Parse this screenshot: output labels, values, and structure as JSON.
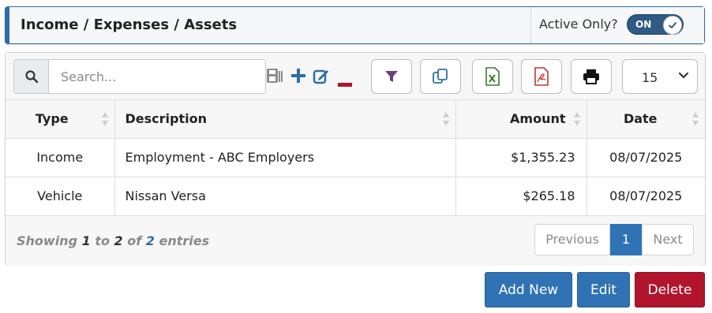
{
  "header": {
    "title": "Income / Expenses / Assets",
    "active_label": "Active Only?",
    "toggle_text": "ON"
  },
  "toolbar": {
    "search_placeholder": "Search...",
    "page_size": "15",
    "icons": [
      "search-icon",
      "save-icon",
      "plus-icon",
      "edit-icon",
      "minus-icon",
      "filter-icon",
      "copy-icon",
      "excel-icon",
      "pdf-icon",
      "print-icon",
      "chevron-down-icon"
    ]
  },
  "table": {
    "columns": [
      "Type",
      "Description",
      "Amount",
      "Date"
    ],
    "rows": [
      {
        "type": "Income",
        "description": "Employment - ABC Employers",
        "amount": "$1,355.23",
        "date": "08/07/2025"
      },
      {
        "type": "Vehicle",
        "description": "Nissan Versa",
        "amount": "$265.18",
        "date": "08/07/2025"
      }
    ]
  },
  "footer": {
    "showing_prefix": "Showing",
    "from": "1",
    "to_word": "to",
    "to": "2",
    "of_word": "of",
    "total": "2",
    "entries_word": "entries",
    "prev_label": "Previous",
    "page": "1",
    "next_label": "Next"
  },
  "actions": {
    "add_label": "Add New",
    "edit_label": "Edit",
    "delete_label": "Delete"
  },
  "colors": {
    "primary": "#2f73b4",
    "danger": "#b0152d",
    "toggle": "#2f5a86"
  }
}
